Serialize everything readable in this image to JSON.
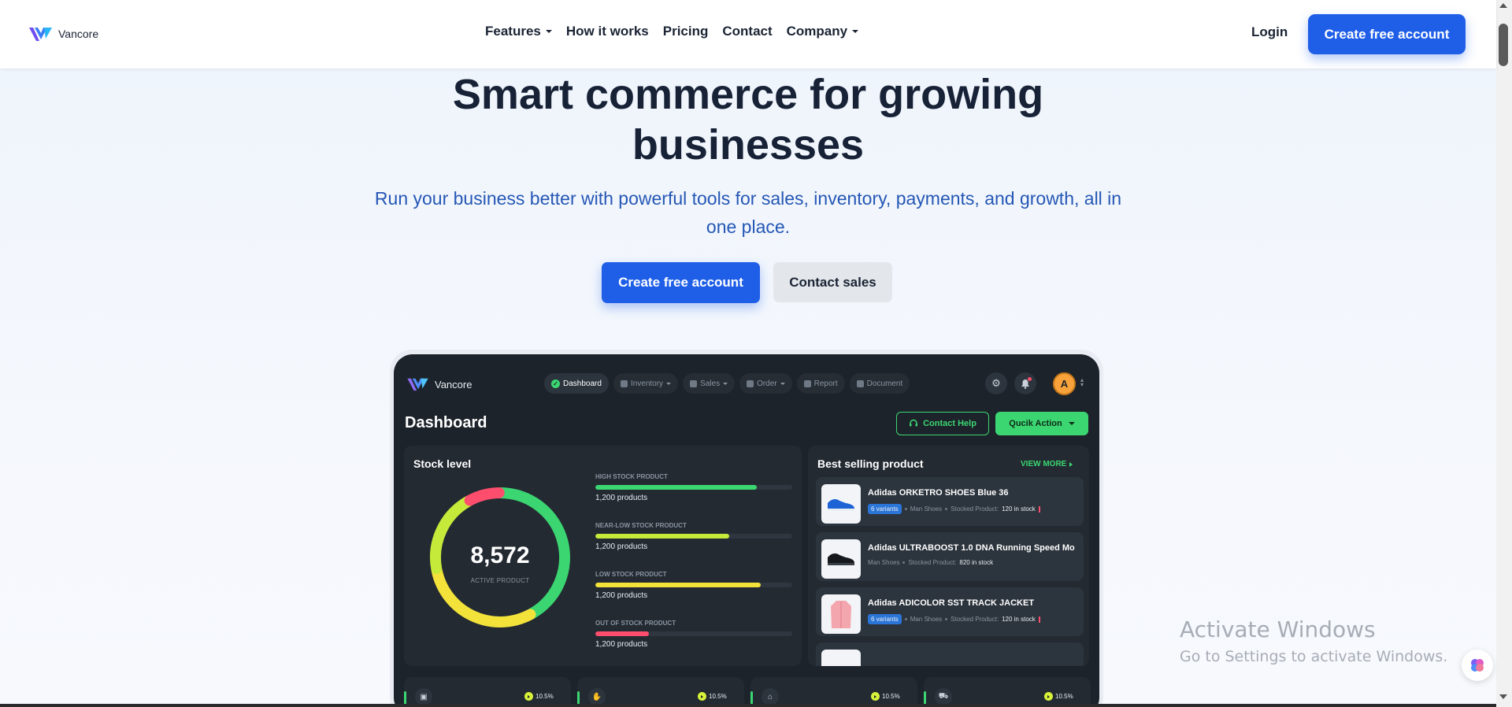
{
  "brand": {
    "name": "Vancore",
    "accent": "#1f5fe8",
    "success": "#3bd671"
  },
  "nav": {
    "links": [
      {
        "label": "Features",
        "has_dropdown": true
      },
      {
        "label": "How it works",
        "has_dropdown": false
      },
      {
        "label": "Pricing",
        "has_dropdown": false
      },
      {
        "label": "Contact",
        "has_dropdown": false
      },
      {
        "label": "Company",
        "has_dropdown": true
      }
    ],
    "login": "Login",
    "cta": "Create free account"
  },
  "hero": {
    "title_line1": "Smart commerce for growing",
    "title_line2": "businesses",
    "subtitle": "Run your business better with powerful tools for sales, inventory, payments, and growth, all in one place.",
    "primary_cta": "Create free account",
    "secondary_cta": "Contact sales"
  },
  "dashboard": {
    "brand": "Vancore",
    "tabs": [
      {
        "label": "Dashboard",
        "active": true,
        "has_dropdown": false
      },
      {
        "label": "Inventory",
        "active": false,
        "has_dropdown": true
      },
      {
        "label": "Sales",
        "active": false,
        "has_dropdown": true
      },
      {
        "label": "Order",
        "active": false,
        "has_dropdown": true
      },
      {
        "label": "Report",
        "active": false,
        "has_dropdown": false
      },
      {
        "label": "Document",
        "active": false,
        "has_dropdown": false
      }
    ],
    "icons": [
      "settings-icon",
      "bell-icon"
    ],
    "avatar_initial": "A",
    "title": "Dashboard",
    "contact_help": "Contact Help",
    "quick_action": "Qucik Action",
    "stock": {
      "title": "Stock level",
      "total": "8,572",
      "total_caption": "ACTIVE PRODUCT",
      "rows": [
        {
          "label": "HIGH STOCK PRODUCT",
          "count": "1,200 products",
          "fill": 0.82,
          "color": "#3bd671"
        },
        {
          "label": "NEAR-LOW STOCK PRODUCT",
          "count": "1,200 products",
          "fill": 0.68,
          "color": "#c6ea3a"
        },
        {
          "label": "LOW STOCK PRODUCT",
          "count": "1,200 products",
          "fill": 0.84,
          "color": "#f2e23a"
        },
        {
          "label": "OUT OF STOCK PRODUCT",
          "count": "1,200 products",
          "fill": 0.27,
          "color": "#ff4d6d"
        }
      ],
      "gauge_segments": [
        {
          "name": "high",
          "fraction": 0.42,
          "color": "#3bd671"
        },
        {
          "name": "low",
          "fraction": 0.3,
          "color": "#f2e23a"
        },
        {
          "name": "near-low",
          "fraction": 0.2,
          "color": "#c6ea3a"
        },
        {
          "name": "out",
          "fraction": 0.08,
          "color": "#ff4d6d"
        }
      ]
    },
    "best": {
      "title": "Best selling product",
      "view_more": "VIEW MORE",
      "products": [
        {
          "name": "Adidas ORKETRO SHOES Blue  36",
          "variants": "6 variants",
          "category": "Man Shoes",
          "stock_label": "Stocked Product:",
          "stock_value": "120 in stock",
          "thumb": "blue-shoe"
        },
        {
          "name": "Adidas ULTRABOOST 1.0 DNA Running Speed Mo",
          "variants": "",
          "category": "Man Shoes",
          "stock_label": "Stocked Product:",
          "stock_value": "820 in stock",
          "thumb": "black-shoe"
        },
        {
          "name": "Adidas ADICOLOR SST TRACK JACKET",
          "variants": "6 variants",
          "category": "Man Shoes",
          "stock_label": "Stocked Product:",
          "stock_value": "120 in stock",
          "thumb": "pink-jacket"
        }
      ]
    },
    "stat_cards": [
      {
        "icon": "box-icon",
        "change": "10.5%"
      },
      {
        "icon": "hand-box-icon",
        "change": "10.5%"
      },
      {
        "icon": "warehouse-icon",
        "change": "10.5%"
      },
      {
        "icon": "truck-icon",
        "change": "10.5%"
      }
    ]
  },
  "watermark": {
    "title": "Activate Windows",
    "subtitle": "Go to Settings to activate Windows."
  }
}
